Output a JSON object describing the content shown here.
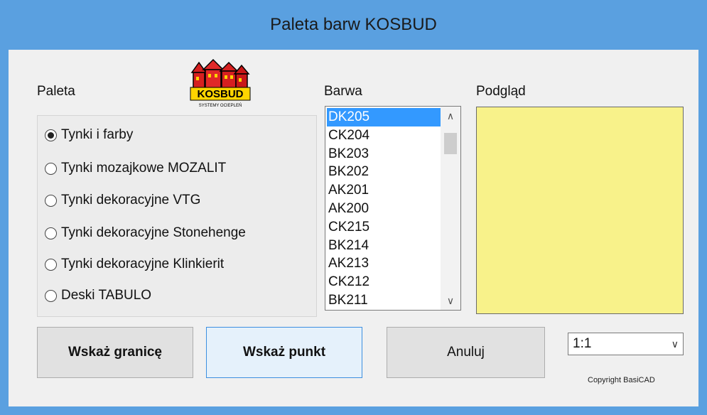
{
  "window": {
    "title": "Paleta barw KOSBUD"
  },
  "labels": {
    "paleta": "Paleta",
    "barwa": "Barwa",
    "podglad": "Podgląd"
  },
  "logo": {
    "brand": "KOSBUD",
    "tagline": "SYSTEMY OCIEPLEŃ",
    "icon": "houses-logo"
  },
  "palette_options": [
    {
      "label": "Tynki i farby",
      "checked": true
    },
    {
      "label": "Tynki mozajkowe MOZALIT",
      "checked": false
    },
    {
      "label": "Tynki dekoracyjne VTG",
      "checked": false
    },
    {
      "label": "Tynki dekoracyjne Stonehenge",
      "checked": false
    },
    {
      "label": "Tynki dekoracyjne Klinkierit",
      "checked": false
    },
    {
      "label": "Deski TABULO",
      "checked": false
    }
  ],
  "colors_list": [
    "DK205",
    "CK204",
    "BK203",
    "BK202",
    "AK201",
    "AK200",
    "CK215",
    "BK214",
    "AK213",
    "CK212",
    "BK211"
  ],
  "selected_color": "DK205",
  "preview": {
    "color": "#f8f28a"
  },
  "buttons": {
    "boundary": "Wskaż granicę",
    "point": "Wskaż punkt",
    "cancel": "Anuluj"
  },
  "scale": {
    "value": "1:1"
  },
  "copyright": "Copyright BasiCAD",
  "colors": {
    "title_bar": "#5aa0e0",
    "selection": "#3399ff"
  }
}
